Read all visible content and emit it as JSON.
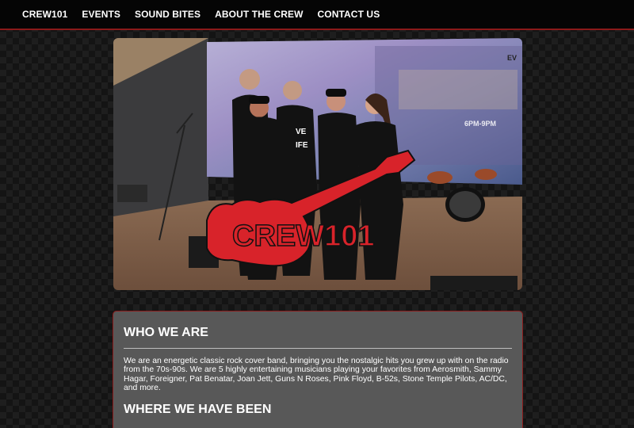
{
  "nav": {
    "items": [
      "CREW101",
      "EVENTS",
      "SOUND BITES",
      "ABOUT THE CREW",
      "CONTACT US"
    ]
  },
  "hero": {
    "logo_text": "CREW101",
    "screen_text_1": "EV",
    "screen_text_2": "6PM-9PM",
    "shirt_text": "VE\nIFE"
  },
  "about": {
    "heading_1": "WHO WE ARE",
    "paragraph": "We are an energetic classic rock cover band, bringing you the nostalgic hits you grew up with on the radio from the 70s-90s. We are 5 highly entertaining musicians playing your favorites from Aerosmith, Sammy Hagar, Foreigner, Pat Benatar, Joan Jett, Guns N Roses, Pink Floyd, B-52s, Stone Temple Pilots, AC/DC, and more.",
    "heading_2": "WHERE WE HAVE BEEN"
  },
  "colors": {
    "accent": "#8b1a1a",
    "logo_red": "#d8232a",
    "nav_bg": "#050505",
    "panel_bg": "#585858"
  }
}
